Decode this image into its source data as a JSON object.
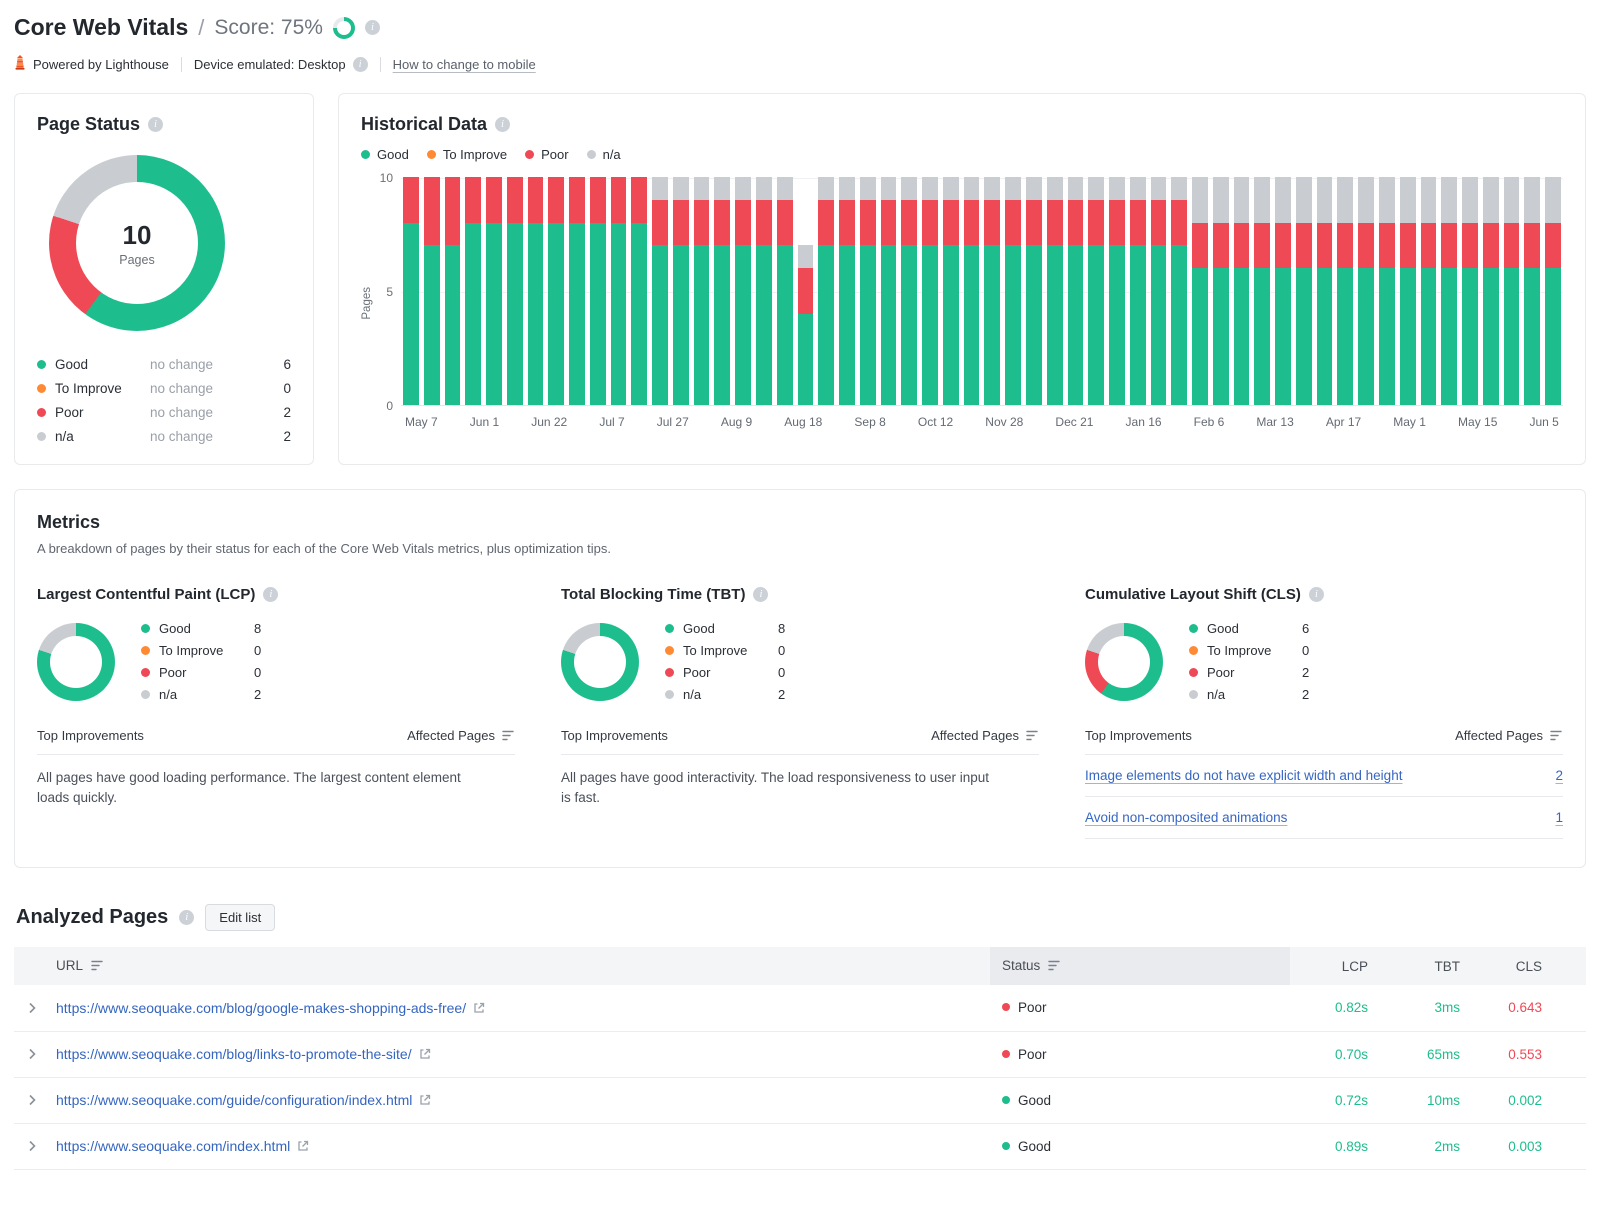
{
  "icons": {
    "info": "i"
  },
  "colors": {
    "good": "#1ebd8d",
    "improve": "#ff8a33",
    "poor": "#ef4956",
    "na": "#c9ccd1",
    "link": "#3565c0",
    "ring_track": "#e7e9ec"
  },
  "header": {
    "title": "Core Web Vitals",
    "separator": "/",
    "score_label": "Score: 75%",
    "score_pct": 75,
    "powered_by": "Powered by Lighthouse",
    "device": "Device emulated: Desktop",
    "mobile_link": "How to change to mobile"
  },
  "page_status": {
    "title": "Page Status",
    "total": "10",
    "total_label": "Pages",
    "legend": [
      {
        "label": "Good",
        "change": "no change",
        "value": "6",
        "color": "good"
      },
      {
        "label": "To Improve",
        "change": "no change",
        "value": "0",
        "color": "improve"
      },
      {
        "label": "Poor",
        "change": "no change",
        "value": "2",
        "color": "poor"
      },
      {
        "label": "n/a",
        "change": "no change",
        "value": "2",
        "color": "na"
      }
    ]
  },
  "historical": {
    "title": "Historical Data",
    "type": "stacked-bar",
    "legend": [
      {
        "label": "Good",
        "color": "good"
      },
      {
        "label": "To Improve",
        "color": "improve"
      },
      {
        "label": "Poor",
        "color": "poor"
      },
      {
        "label": "n/a",
        "color": "na"
      }
    ],
    "ylabel": "Pages",
    "yticks": [
      "10",
      "5",
      "0"
    ],
    "ymax": 10,
    "x_ticks": [
      "May 7",
      "Jun 1",
      "Jun 22",
      "Jul 7",
      "Jul 27",
      "Aug 9",
      "Aug 18",
      "Sep 8",
      "Oct 12",
      "Nov 28",
      "Dec 21",
      "Jan 16",
      "Feb 6",
      "Mar 13",
      "Apr 17",
      "May 1",
      "May 15",
      "Jun 5"
    ],
    "series_order": [
      "good",
      "poor",
      "na"
    ],
    "bars": [
      [
        8,
        2,
        0
      ],
      [
        7,
        3,
        0
      ],
      [
        7,
        3,
        0
      ],
      [
        8,
        2,
        0
      ],
      [
        8,
        2,
        0
      ],
      [
        8,
        2,
        0
      ],
      [
        8,
        2,
        0
      ],
      [
        8,
        2,
        0
      ],
      [
        8,
        2,
        0
      ],
      [
        8,
        2,
        0
      ],
      [
        8,
        2,
        0
      ],
      [
        8,
        2,
        0
      ],
      [
        7,
        2,
        1
      ],
      [
        7,
        2,
        1
      ],
      [
        7,
        2,
        1
      ],
      [
        7,
        2,
        1
      ],
      [
        7,
        2,
        1
      ],
      [
        7,
        2,
        1
      ],
      [
        7,
        2,
        1
      ],
      [
        4,
        2,
        1
      ],
      [
        7,
        2,
        1
      ],
      [
        7,
        2,
        1
      ],
      [
        7,
        2,
        1
      ],
      [
        7,
        2,
        1
      ],
      [
        7,
        2,
        1
      ],
      [
        7,
        2,
        1
      ],
      [
        7,
        2,
        1
      ],
      [
        7,
        2,
        1
      ],
      [
        7,
        2,
        1
      ],
      [
        7,
        2,
        1
      ],
      [
        7,
        2,
        1
      ],
      [
        7,
        2,
        1
      ],
      [
        7,
        2,
        1
      ],
      [
        7,
        2,
        1
      ],
      [
        7,
        2,
        1
      ],
      [
        7,
        2,
        1
      ],
      [
        7,
        2,
        1
      ],
      [
        7,
        2,
        1
      ],
      [
        6,
        2,
        2
      ],
      [
        6,
        2,
        2
      ],
      [
        6,
        2,
        2
      ],
      [
        6,
        2,
        2
      ],
      [
        6,
        2,
        2
      ],
      [
        6,
        2,
        2
      ],
      [
        6,
        2,
        2
      ],
      [
        6,
        2,
        2
      ],
      [
        6,
        2,
        2
      ],
      [
        6,
        2,
        2
      ],
      [
        6,
        2,
        2
      ],
      [
        6,
        2,
        2
      ],
      [
        6,
        2,
        2
      ],
      [
        6,
        2,
        2
      ],
      [
        6,
        2,
        2
      ],
      [
        6,
        2,
        2
      ],
      [
        6,
        2,
        2
      ],
      [
        6,
        2,
        2
      ]
    ]
  },
  "metrics": {
    "title": "Metrics",
    "subtitle": "A breakdown of pages by their status for each of the Core Web Vitals metrics, plus optimization tips.",
    "improvements_header": "Top Improvements",
    "affected_header": "Affected Pages",
    "items": [
      {
        "title": "Largest Contentful Paint (LCP)",
        "legend": [
          {
            "label": "Good",
            "value": "8",
            "color": "good"
          },
          {
            "label": "To Improve",
            "value": "0",
            "color": "improve"
          },
          {
            "label": "Poor",
            "value": "0",
            "color": "poor"
          },
          {
            "label": "n/a",
            "value": "2",
            "color": "na"
          }
        ],
        "content": {
          "type": "text",
          "text": "All pages have good loading performance. The largest content element loads quickly."
        }
      },
      {
        "title": "Total Blocking Time (TBT)",
        "legend": [
          {
            "label": "Good",
            "value": "8",
            "color": "good"
          },
          {
            "label": "To Improve",
            "value": "0",
            "color": "improve"
          },
          {
            "label": "Poor",
            "value": "0",
            "color": "poor"
          },
          {
            "label": "n/a",
            "value": "2",
            "color": "na"
          }
        ],
        "content": {
          "type": "text",
          "text": "All pages have good interactivity. The load responsiveness to user input is fast."
        }
      },
      {
        "title": "Cumulative Layout Shift (CLS)",
        "legend": [
          {
            "label": "Good",
            "value": "6",
            "color": "good"
          },
          {
            "label": "To Improve",
            "value": "0",
            "color": "improve"
          },
          {
            "label": "Poor",
            "value": "2",
            "color": "poor"
          },
          {
            "label": "n/a",
            "value": "2",
            "color": "na"
          }
        ],
        "content": {
          "type": "links",
          "rows": [
            {
              "label": "Image elements do not have explicit width and height",
              "count": "2"
            },
            {
              "label": "Avoid non-composited animations",
              "count": "1"
            }
          ]
        }
      }
    ]
  },
  "analyzed": {
    "title": "Analyzed Pages",
    "edit_button": "Edit list",
    "columns": {
      "url": "URL",
      "status": "Status",
      "lcp": "LCP",
      "tbt": "TBT",
      "cls": "CLS"
    },
    "rows": [
      {
        "url": "https://www.seoquake.com/blog/google-makes-shopping-ads-free/",
        "status": "Poor",
        "status_color": "poor",
        "lcp": "0.82s",
        "lcp_color": "good",
        "tbt": "3ms",
        "tbt_color": "good",
        "cls": "0.643",
        "cls_color": "poor"
      },
      {
        "url": "https://www.seoquake.com/blog/links-to-promote-the-site/",
        "status": "Poor",
        "status_color": "poor",
        "lcp": "0.70s",
        "lcp_color": "good",
        "tbt": "65ms",
        "tbt_color": "good",
        "cls": "0.553",
        "cls_color": "poor"
      },
      {
        "url": "https://www.seoquake.com/guide/configuration/index.html",
        "status": "Good",
        "status_color": "good",
        "lcp": "0.72s",
        "lcp_color": "good",
        "tbt": "10ms",
        "tbt_color": "good",
        "cls": "0.002",
        "cls_color": "good"
      },
      {
        "url": "https://www.seoquake.com/index.html",
        "status": "Good",
        "status_color": "good",
        "lcp": "0.89s",
        "lcp_color": "good",
        "tbt": "2ms",
        "tbt_color": "good",
        "cls": "0.003",
        "cls_color": "good"
      }
    ]
  }
}
